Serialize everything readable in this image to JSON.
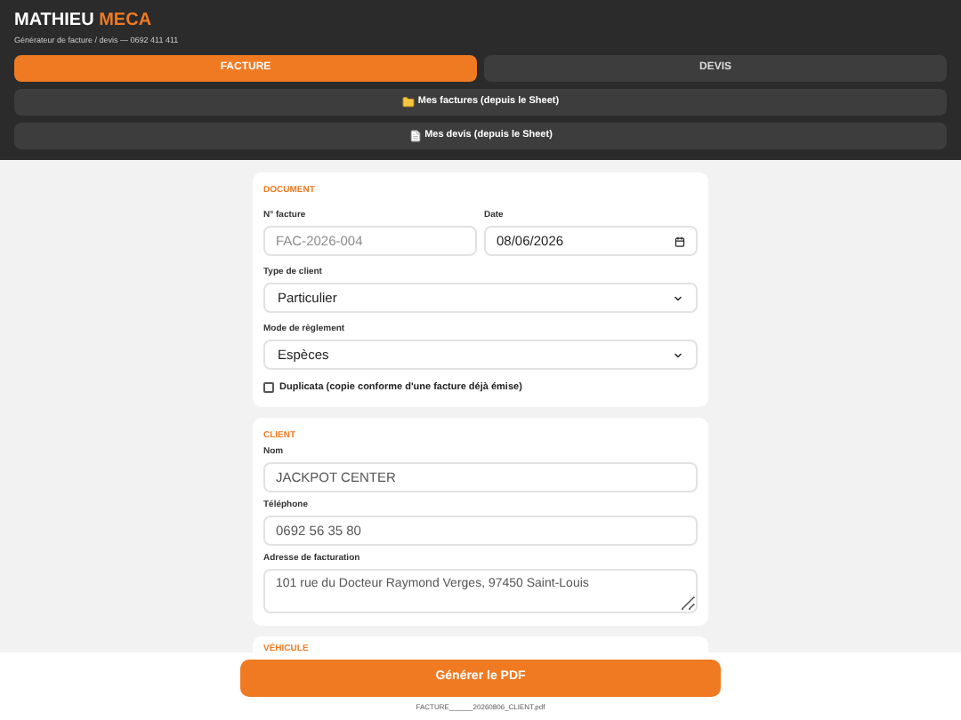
{
  "header": {
    "brand_first": "MATHIEU",
    "brand_accent": "MECA",
    "subtitle": "Générateur de facture / devis — 0692 411 411"
  },
  "tabs": [
    {
      "label": "FACTURE",
      "selected": true
    },
    {
      "label": "DEVIS",
      "selected": false
    }
  ],
  "links": [
    {
      "kind": "invoices",
      "label": "Mes factures (depuis le Sheet)"
    },
    {
      "kind": "quotes",
      "label": "Mes devis (depuis le Sheet)"
    }
  ],
  "document": {
    "title": "DOCUMENT",
    "invoice_number": {
      "label": "N° facture",
      "placeholder": "FAC-2026-004"
    },
    "date": {
      "label": "Date",
      "value": "08/06/2026"
    },
    "client_type": {
      "label": "Type de client",
      "value": "Particulier"
    },
    "payment_mode": {
      "label": "Mode de règlement",
      "value": "Espèces"
    },
    "duplicate": {
      "label": "Duplicata (copie conforme d'une facture déjà émise)",
      "checked": false
    }
  },
  "client": {
    "title": "CLIENT",
    "name": {
      "label": "Nom",
      "value": "JACKPOT CENTER"
    },
    "phone": {
      "label": "Téléphone",
      "value": "0692 56 35 80"
    },
    "address": {
      "label": "Adresse de facturation",
      "value": "101 rue du Docteur Raymond Verges, 97450 Saint-Louis"
    }
  },
  "vehicle": {
    "title": "VÉHICULE"
  },
  "footer": {
    "button": "Générer le PDF",
    "filename": "FACTURE______20260806_CLIENT.pdf"
  }
}
